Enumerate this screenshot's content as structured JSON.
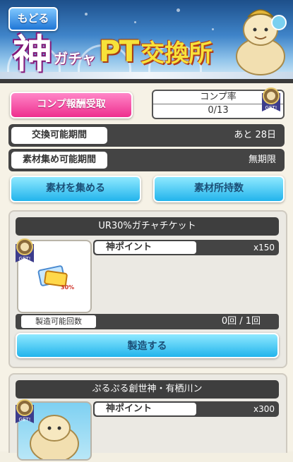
{
  "header": {
    "back_label": "もどる",
    "title_kami": "神",
    "title_gacha": "ガチャ",
    "title_pt": "PT",
    "title_shop": "交換所"
  },
  "summary": {
    "claim_button": "コンプ報酬受取",
    "rate_label": "コンプ率",
    "rate_value": "0/13",
    "get_badge": "GET!"
  },
  "info": {
    "exchange_period_label": "交換可能期間",
    "exchange_period_value": "あと 28日",
    "collect_period_label": "素材集め可能期間",
    "collect_period_value": "無期限"
  },
  "actions": {
    "collect_button": "素材を集める",
    "owned_button": "素材所持数"
  },
  "items": [
    {
      "title": "UR30%ガチャチケット",
      "point_label": "神ポイント",
      "point_value": "x150",
      "count_label": "製造可能回数",
      "count_value": "0回 / 1回",
      "make_button": "製造する",
      "ticket_text": "30%"
    },
    {
      "title": "ぷるぷる創世神・有栖川ン",
      "point_label": "神ポイント",
      "point_value": "x300"
    }
  ],
  "colors": {
    "pink_button": "#ee2f8e",
    "blue_button": "#22b4ec",
    "dark_row": "#444444"
  }
}
